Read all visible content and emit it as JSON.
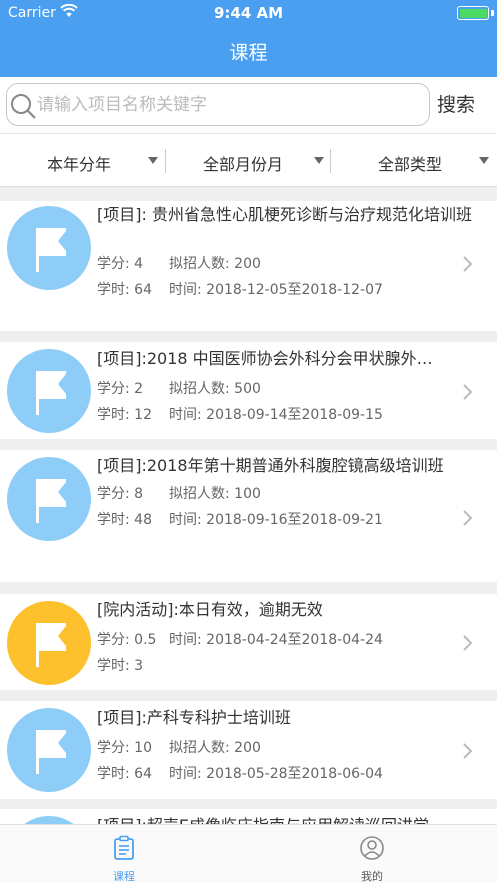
{
  "status_bar": {
    "carrier": "Carrier",
    "time": "9:44 AM"
  },
  "header": {
    "title": "课程"
  },
  "search": {
    "placeholder": "请输入项目名称关键字",
    "button_label": "搜索"
  },
  "filters": [
    {
      "label": "本年分年"
    },
    {
      "label": "全部月份月"
    },
    {
      "label": "全部类型"
    }
  ],
  "courses": [
    {
      "title": "[项目]: 贵州省急性心肌梗死诊断与治疗规范化培训班",
      "credit": "学分: 4",
      "quota": "拟招人数: 200",
      "hours": "学时: 64",
      "period": "时间: 2018-12-05至2018-12-07",
      "color": "blue"
    },
    {
      "title": "[项目]:2018 中国医师协会外科分会甲状腺外…",
      "credit": "学分: 2",
      "quota": "拟招人数: 500",
      "hours": "学时: 12",
      "period": "时间: 2018-09-14至2018-09-15",
      "color": "blue"
    },
    {
      "title": "[项目]:2018年第十期普通外科腹腔镜高级培训班",
      "credit": "学分: 8",
      "quota": "拟招人数: 100",
      "hours": "学时: 48",
      "period": "时间: 2018-09-16至2018-09-21",
      "color": "blue"
    },
    {
      "title": "[院内活动]:本日有效，逾期无效",
      "credit": "学分: 0.5",
      "period": "时间: 2018-04-24至2018-04-24",
      "hours": "学时: 3",
      "color": "yellow"
    },
    {
      "title": "[项目]:产科专科护士培训班",
      "credit": "学分: 10",
      "quota": "拟招人数: 200",
      "hours": "学时: 64",
      "period": "时间: 2018-05-28至2018-06-04",
      "color": "blue"
    },
    {
      "title": "[项目]:超声E成像临床指南与应用解读巡回讲学",
      "color": "blue"
    }
  ],
  "tabs": [
    {
      "label": "课程",
      "icon": "clipboard-icon",
      "active": true
    },
    {
      "label": "我的",
      "icon": "user-icon",
      "active": false
    }
  ],
  "colors": {
    "primary": "#4a9ff0",
    "avatar_blue": "#8ecdf8",
    "avatar_yellow": "#fcc12d",
    "battery": "#4cd964"
  }
}
